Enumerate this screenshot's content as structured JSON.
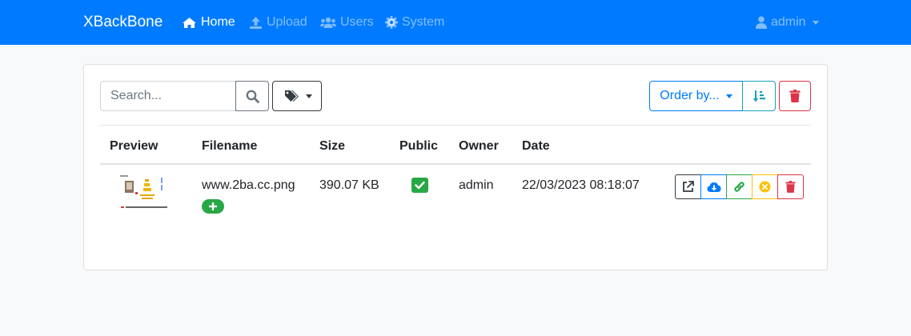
{
  "app": {
    "brand": "XBackBone"
  },
  "nav": {
    "items": [
      {
        "label": "Home",
        "icon": "home-icon"
      },
      {
        "label": "Upload",
        "icon": "upload-icon"
      },
      {
        "label": "Users",
        "icon": "users-icon"
      },
      {
        "label": "System",
        "icon": "cog-icon"
      }
    ],
    "user": {
      "label": "admin",
      "icon": "user-icon"
    }
  },
  "toolbar": {
    "search_placeholder": "Search...",
    "order_label": "Order by..."
  },
  "table": {
    "headers": [
      "Preview",
      "Filename",
      "Size",
      "Public",
      "Owner",
      "Date"
    ],
    "rows": [
      {
        "filename": "www.2ba.cc.png",
        "size": "390.07 KB",
        "public": true,
        "owner": "admin",
        "date": "22/03/2023 08:18:07"
      }
    ]
  },
  "colors": {
    "primary": "#007bff",
    "success": "#28a745",
    "danger": "#dc3545",
    "info": "#17a2b8",
    "warning": "#ffc107",
    "secondary": "#6c757d",
    "dark": "#343a40"
  }
}
